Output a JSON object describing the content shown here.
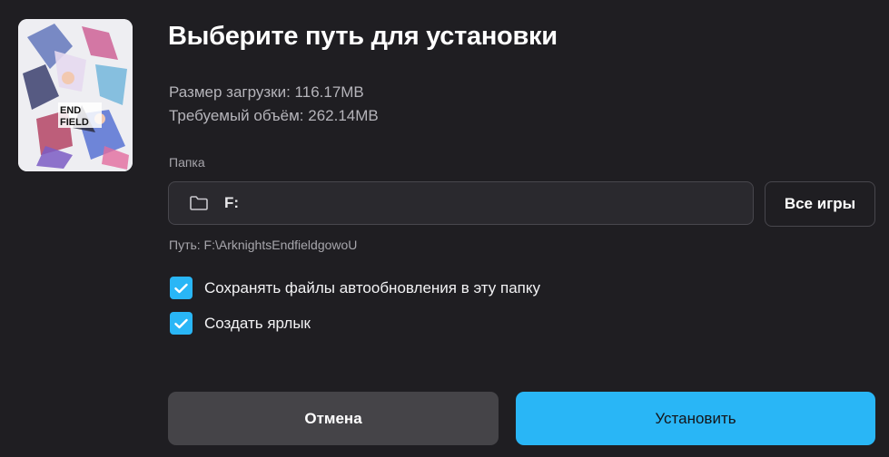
{
  "dialog": {
    "title": "Выберите путь для установки",
    "download_size": "Размер загрузки: 116.17MB",
    "required_space": "Требуемый объём: 262.14MB",
    "folder_label": "Папка",
    "folder_value": "F:",
    "all_games_label": "Все игры",
    "path_hint": "Путь: F:\\ArknightsEndfieldgowoU",
    "checkbox_autoupdate": "Сохранять файлы автообновления в эту папку",
    "checkbox_autoupdate_checked": true,
    "checkbox_shortcut": "Создать ярлык",
    "checkbox_shortcut_checked": true,
    "cancel_label": "Отмена",
    "install_label": "Установить"
  },
  "cover": {
    "logo_line1": "END",
    "logo_line2": "FIELD"
  },
  "colors": {
    "background": "#1f1e22",
    "accent": "#29b6f6",
    "secondary_button": "#454448"
  }
}
